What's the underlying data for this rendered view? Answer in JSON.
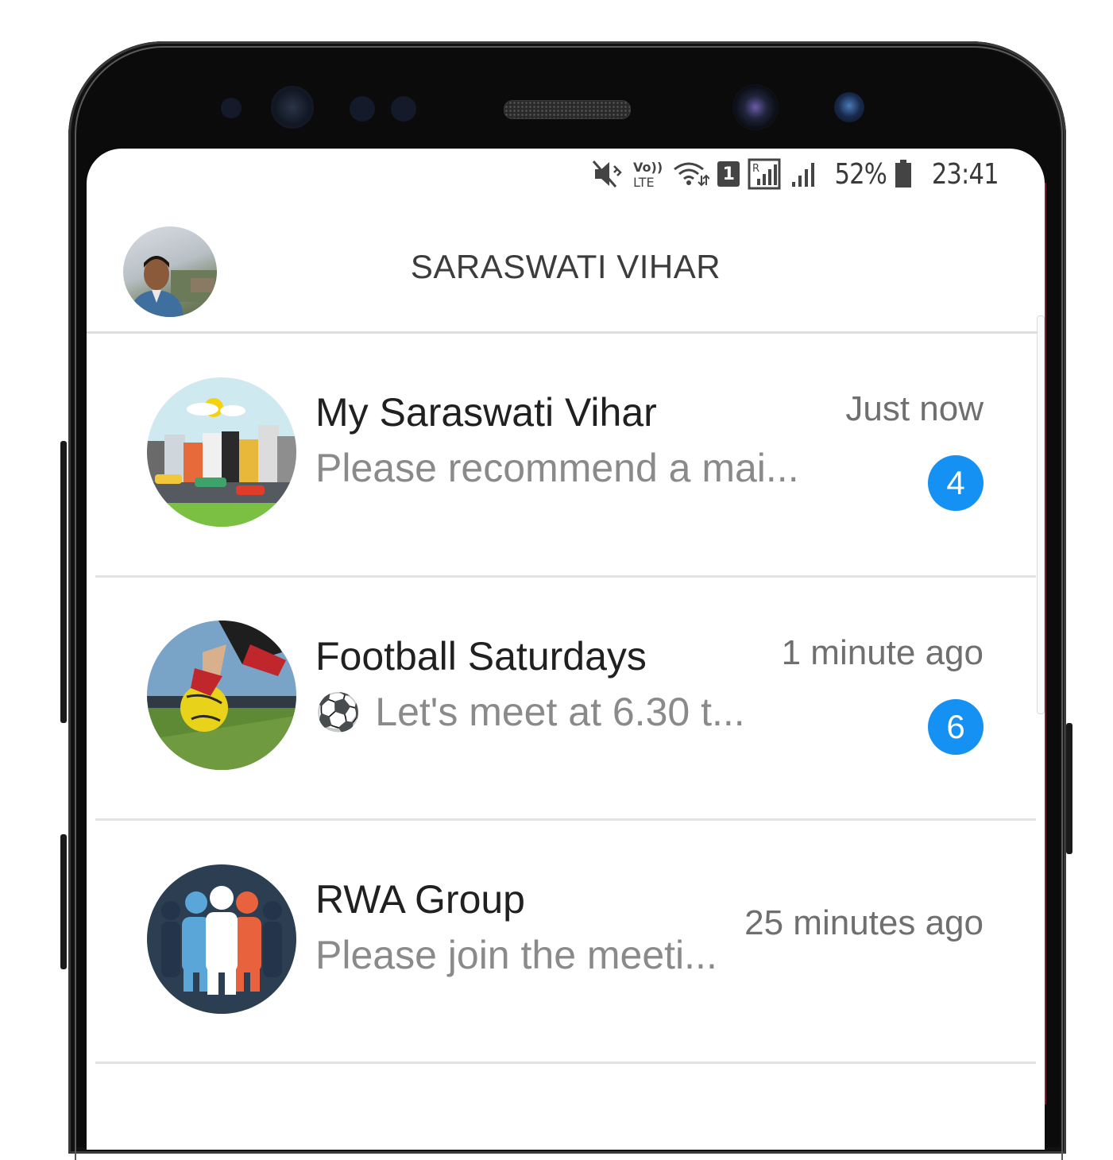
{
  "status_bar": {
    "volte_label": "VoLTE",
    "sim_label": "1",
    "battery_percent": "52%",
    "time": "23:41"
  },
  "header": {
    "title": "SARASWATI VIHAR"
  },
  "chats": [
    {
      "name": "My Saraswati Vihar",
      "preview": "Please recommend a mai...",
      "time": "Just now",
      "unread": "4"
    },
    {
      "name": "Football Saturdays",
      "preview_emoji": "⚽",
      "preview": "Let's meet at 6.30 t...",
      "time": "1 minute ago",
      "unread": "6"
    },
    {
      "name": "RWA Group",
      "preview": "Please join the meeti...",
      "time": "25 minutes ago"
    }
  ],
  "colors": {
    "badge": "#1491f3",
    "title_text": "#3c3c3c",
    "preview_text": "#8a8a8a"
  }
}
